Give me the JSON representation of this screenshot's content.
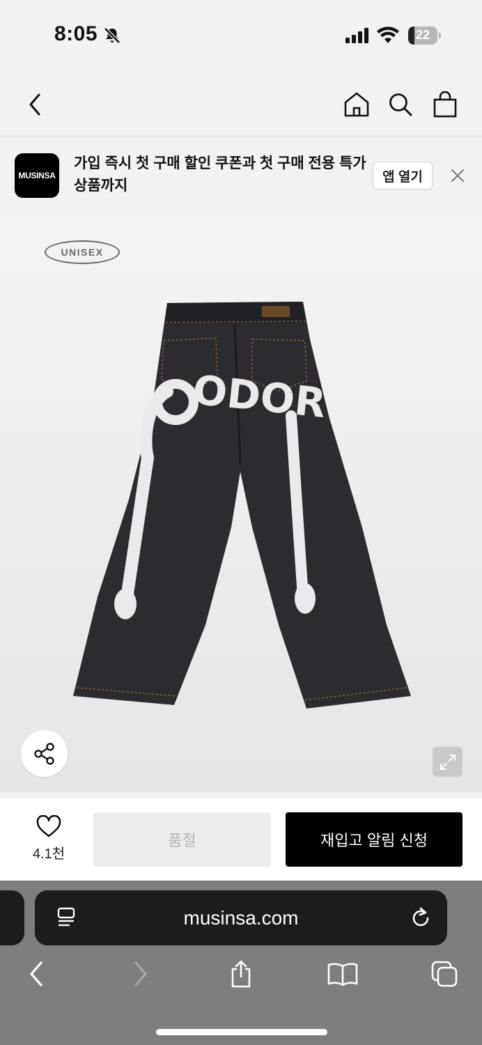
{
  "status": {
    "time": "8:05",
    "battery": "22",
    "battery_level": 0.22
  },
  "nav": {
    "back_icon": "chevron-left-icon",
    "home_icon": "home-icon",
    "search_icon": "search-icon",
    "cart_icon": "shopping-bag-icon"
  },
  "promo": {
    "logo": "MUSINSA",
    "text": "가입 즉시 첫 구매 할인 쿠폰과 첫 구매 전용 특가 상품까지",
    "open_button": "앱 열기"
  },
  "product": {
    "badge": "UNISEX",
    "graphic_text": "ODOR"
  },
  "purchase": {
    "like_count": "4.1천",
    "soldout_label": "품절",
    "restock_label": "재입고 알림 신청"
  },
  "browser": {
    "url": "musinsa.com"
  }
}
